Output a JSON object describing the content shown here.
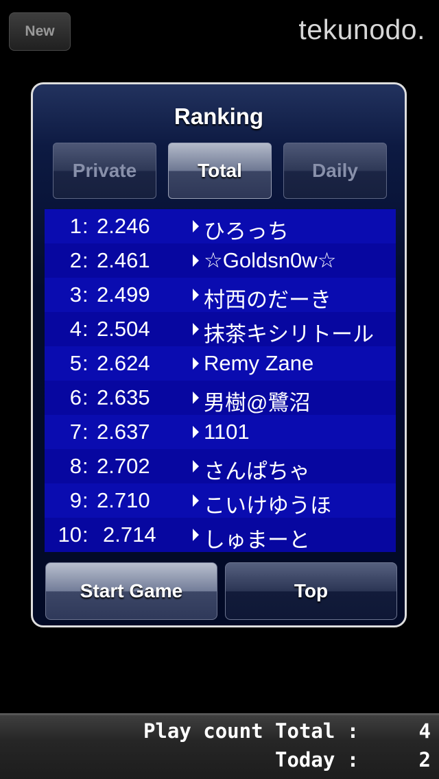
{
  "header": {
    "new_label": "New",
    "logo": "tekunodo."
  },
  "panel": {
    "title": "Ranking",
    "tabs": [
      {
        "label": "Private",
        "active": false
      },
      {
        "label": "Total",
        "active": true
      },
      {
        "label": "Daily",
        "active": false
      }
    ],
    "rankings": [
      {
        "rank": "1",
        "time": "2.246",
        "name": "ひろっち"
      },
      {
        "rank": "2",
        "time": "2.461",
        "name": "☆Goldsn0w☆"
      },
      {
        "rank": "3",
        "time": "2.499",
        "name": "村西のだーき"
      },
      {
        "rank": "4",
        "time": "2.504",
        "name": "抹茶キシリトール"
      },
      {
        "rank": "5",
        "time": "2.624",
        "name": "Remy Zane"
      },
      {
        "rank": "6",
        "time": "2.635",
        "name": "男樹@鷺沼"
      },
      {
        "rank": "7",
        "time": "2.637",
        "name": "1101"
      },
      {
        "rank": "8",
        "time": "2.702",
        "name": "さんぱちゃ"
      },
      {
        "rank": "9",
        "time": "2.710",
        "name": "こいけゆうほ"
      },
      {
        "rank": "10",
        "time": "2.714",
        "name": "しゅまーと"
      }
    ],
    "colon": ":",
    "start_label": "Start Game",
    "top_label": "Top"
  },
  "footer": {
    "total_line": "Play count Total :     4",
    "today_line": "Today :     2"
  },
  "colors": {
    "row_odd": "#0a0cb0",
    "row_even": "#0707a0",
    "panel_border": "#dedede"
  }
}
